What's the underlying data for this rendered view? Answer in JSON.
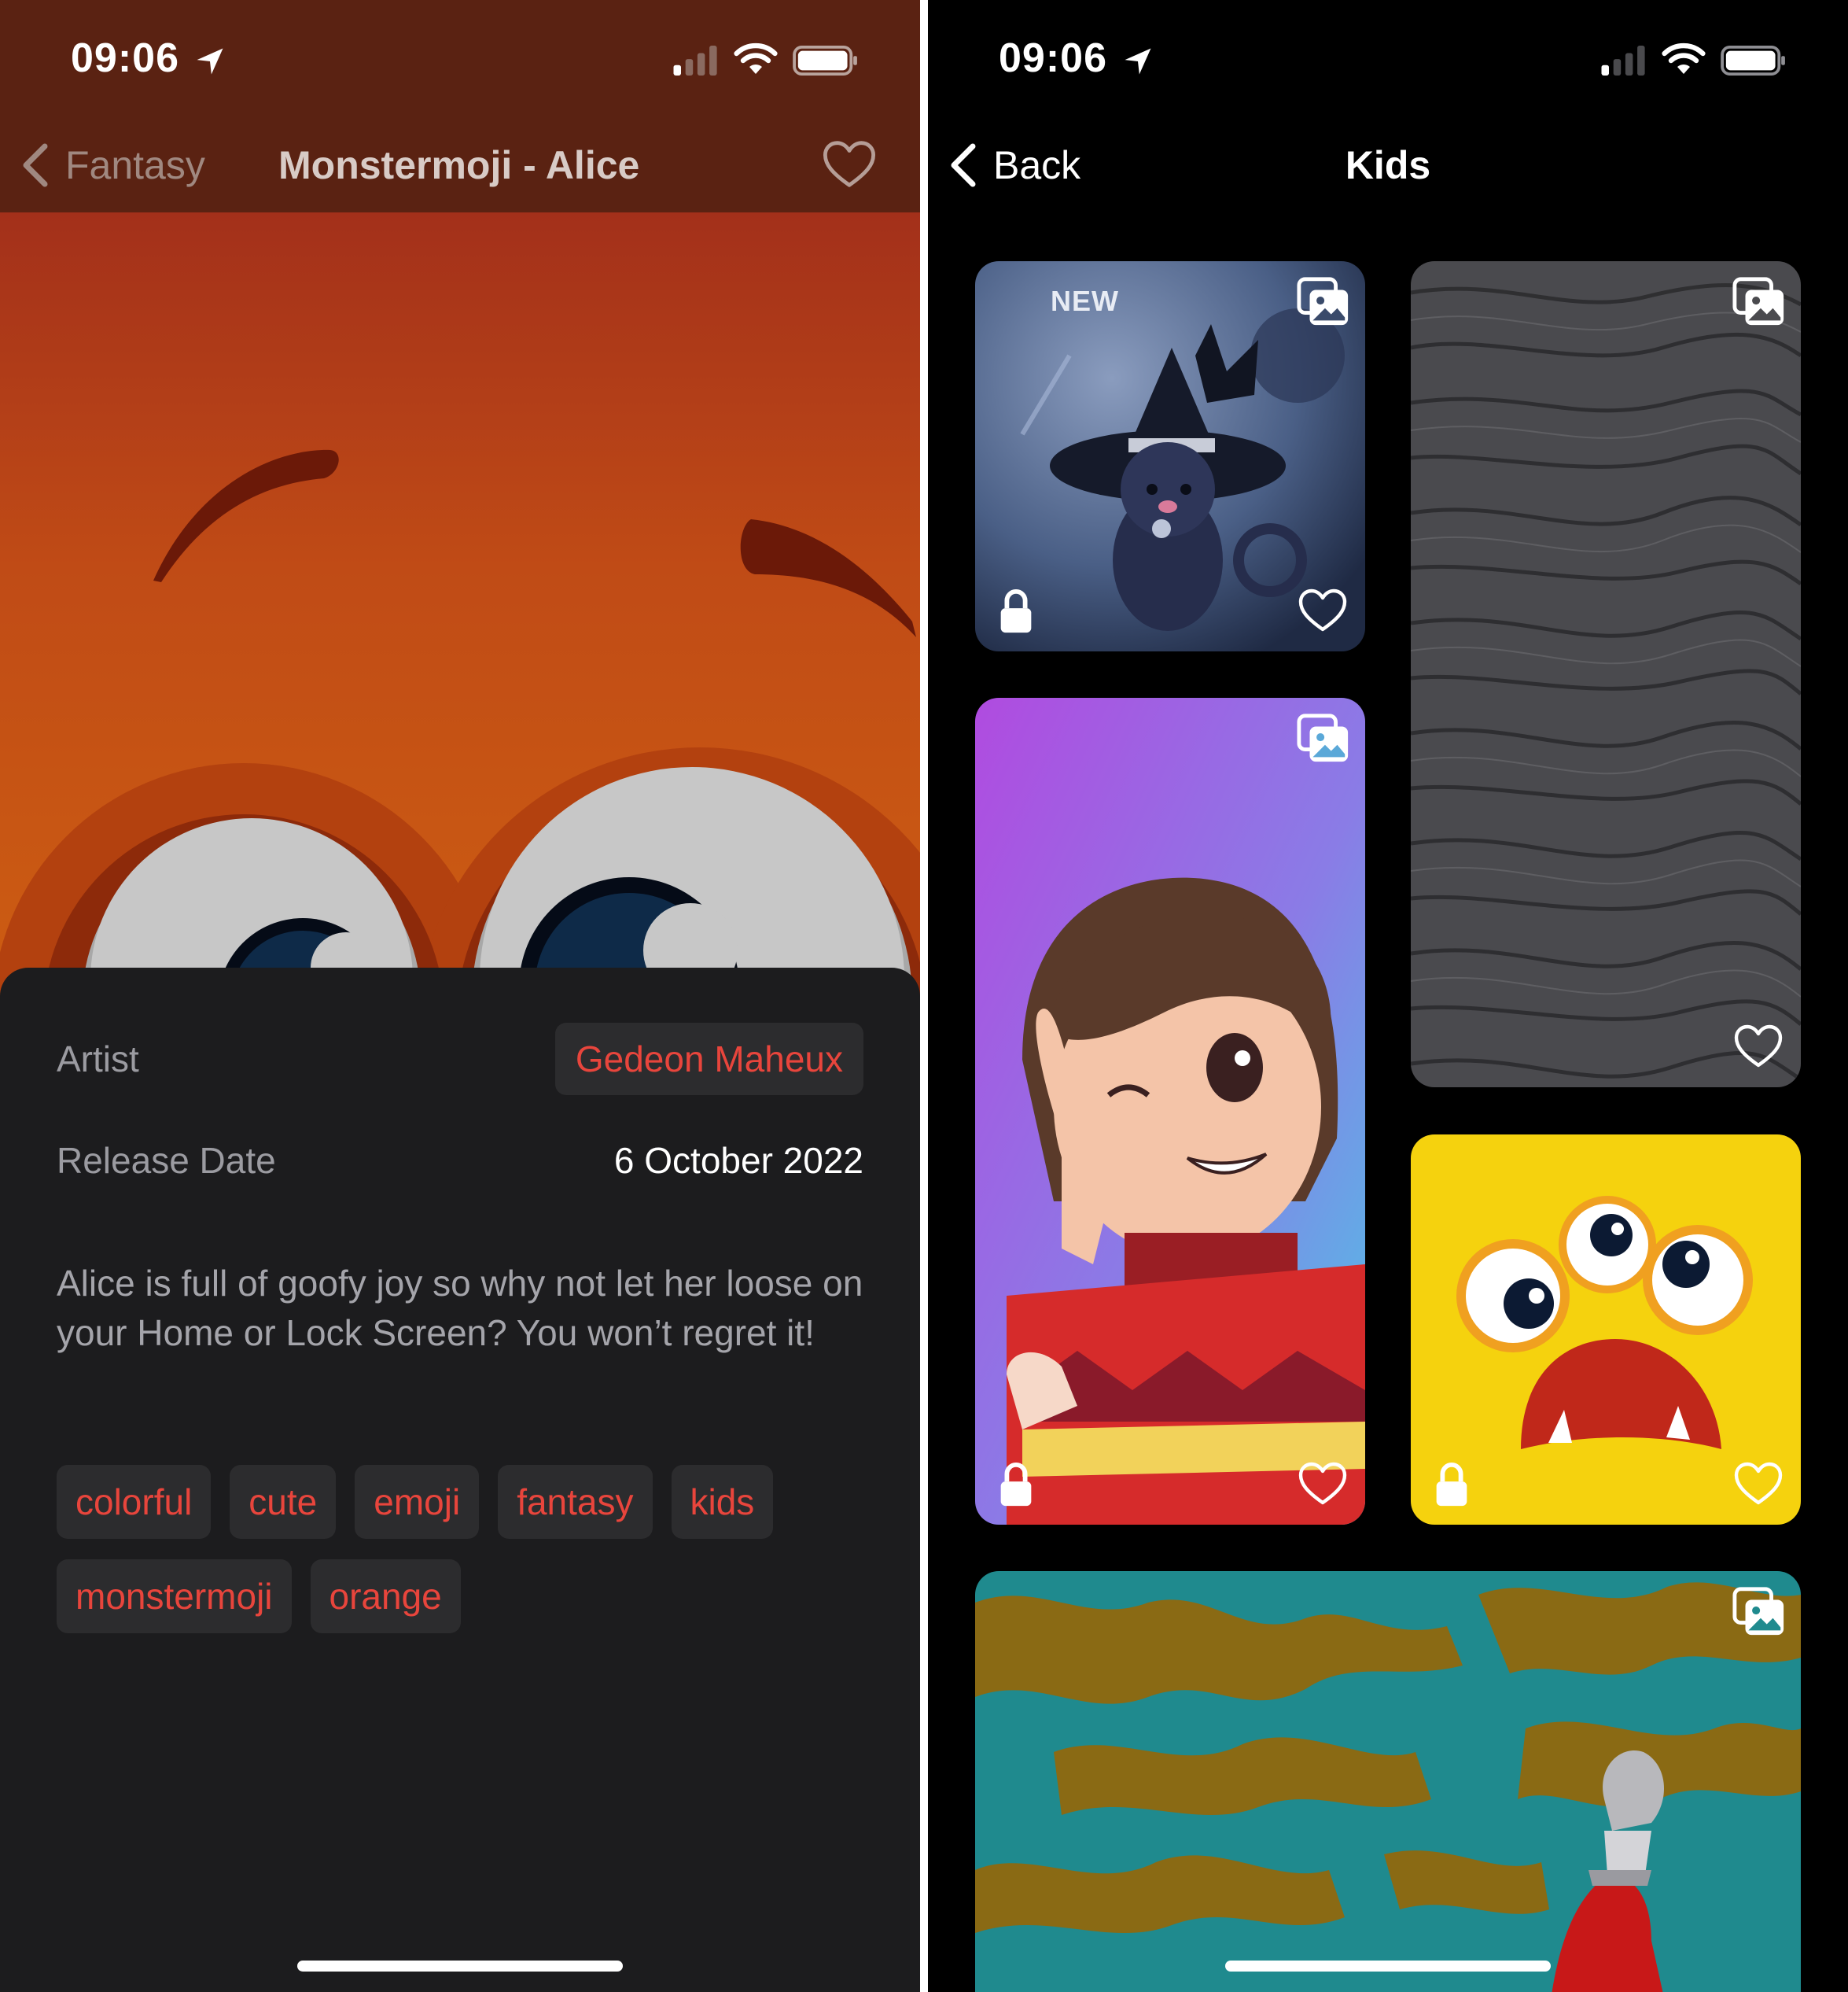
{
  "left_screen": {
    "status_bar": {
      "time": "09:06"
    },
    "nav": {
      "back_label": "Fantasy",
      "title": "Monstermoji - Alice"
    },
    "details": {
      "artist_label": "Artist",
      "artist_name": "Gedeon Maheux",
      "release_label": "Release Date",
      "release_date": "6 October 2022",
      "description": "Alice is full of goofy joy so why not let her loose on your Home or Lock Screen? You won’t regret it!",
      "tags": [
        "colorful",
        "cute",
        "emoji",
        "fantasy",
        "kids",
        "monstermoji",
        "orange"
      ]
    }
  },
  "right_screen": {
    "status_bar": {
      "time": "09:06"
    },
    "nav": {
      "back_label": "Back",
      "title": "Kids"
    },
    "cards": [
      {
        "art": "witch cat",
        "badge": "NEW",
        "gallery_icon": true,
        "locked": true,
        "favorite": false
      },
      {
        "art": "grey waves",
        "gallery_icon": true,
        "locked": false,
        "favorite": false
      },
      {
        "art": "anime girl",
        "gallery_icon": true,
        "locked": true,
        "favorite": false
      },
      {
        "art": "yellow three-eyed monster",
        "gallery_icon": false,
        "locked": true,
        "favorite": false
      },
      {
        "art": "hero on textured background",
        "gallery_icon": true,
        "locked": false,
        "favorite": false
      }
    ]
  },
  "colors": {
    "accent_red": "#e8453c",
    "chip_bg": "#2c2c2e",
    "sheet_bg": "#1c1c1e",
    "left_header_bg": "#5a2212"
  },
  "icons": [
    "location-arrow-icon",
    "cellular-signal-icon",
    "wifi-icon",
    "battery-icon",
    "chevron-left-icon",
    "heart-outline-icon",
    "gallery-icon",
    "lock-icon"
  ]
}
